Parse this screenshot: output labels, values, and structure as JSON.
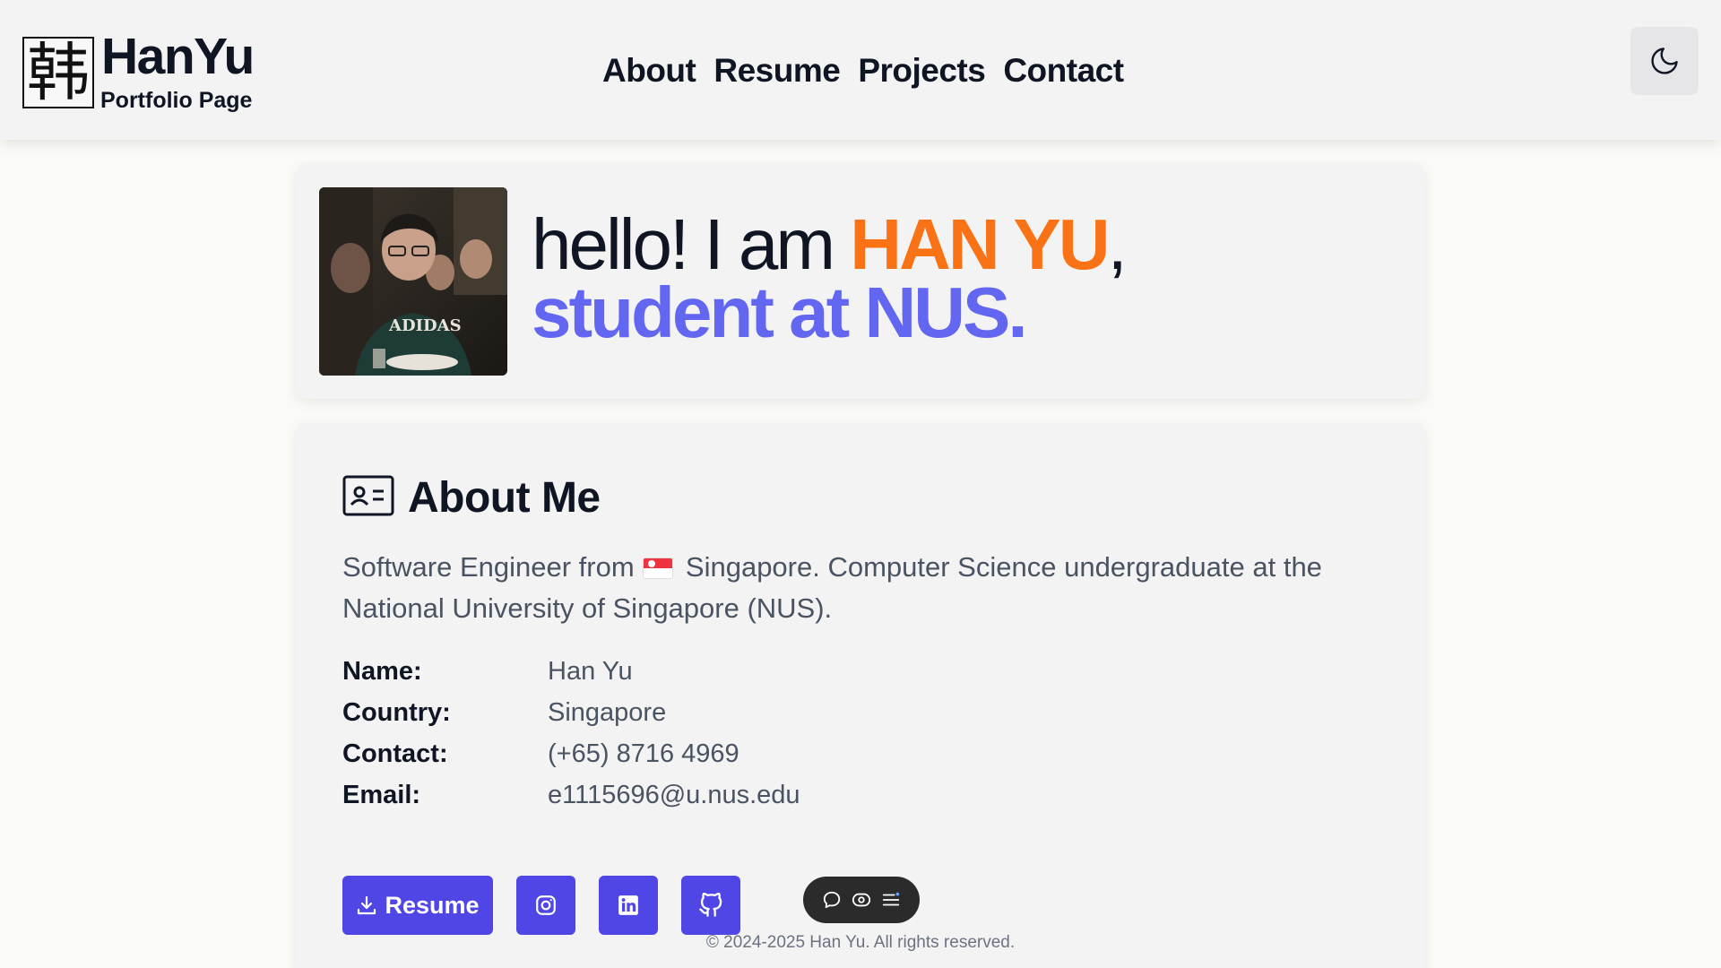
{
  "header": {
    "logo_char": "韩",
    "brand_title": "HanYu",
    "brand_subtitle": "Portfolio Page",
    "nav": [
      {
        "label": "About"
      },
      {
        "label": "Resume"
      },
      {
        "label": "Projects"
      },
      {
        "label": "Contact"
      }
    ],
    "theme_icon": "moon-icon"
  },
  "hero": {
    "line1_prefix": "hello! I am ",
    "name": "HAN YU",
    "line1_suffix": ",",
    "line2": "student at NUS.",
    "name_color": "#f97316",
    "line2_color": "#6366f1"
  },
  "about": {
    "icon": "id-card-icon",
    "title": "About Me",
    "desc_part1": "Software Engineer from",
    "desc_part2": "Singapore. Computer Science undergraduate at the National University of Singapore (NUS).",
    "fields": [
      {
        "label": "Name:",
        "value": "Han Yu"
      },
      {
        "label": "Country:",
        "value": "Singapore"
      },
      {
        "label": "Contact:",
        "value": "(+65) 8716 4969"
      },
      {
        "label": "Email:",
        "value": "e1115696@u.nus.edu"
      }
    ],
    "buttons": {
      "resume_label": "Resume",
      "accent": "#4f46e5",
      "icons": [
        "download-icon",
        "instagram-icon",
        "linkedin-icon",
        "github-icon"
      ]
    }
  },
  "floating_toolbar": {
    "icons": [
      "comment-icon",
      "eye-icon",
      "menu-icon"
    ]
  },
  "footer": {
    "text": "© 2024-2025 Han Yu. All rights reserved."
  }
}
